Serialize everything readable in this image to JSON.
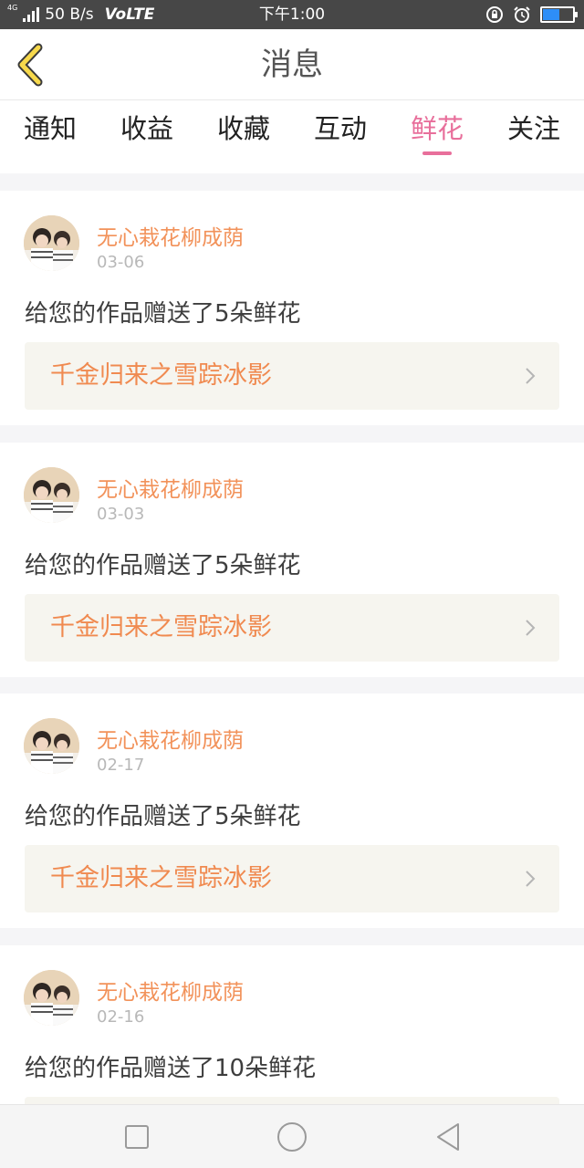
{
  "status_bar": {
    "network_type": "4G",
    "speed": "50 B/s",
    "volte": "VoLTE",
    "time": "下午1:00",
    "icons": [
      "rotation-lock-icon",
      "alarm-icon",
      "battery-icon"
    ],
    "battery_level": 0.55,
    "battery_color": "#2e8ef7"
  },
  "header": {
    "back_icon": "chevron-left-icon",
    "title": "消息"
  },
  "tabs": [
    {
      "label": "通知",
      "active": false
    },
    {
      "label": "收益",
      "active": false
    },
    {
      "label": "收藏",
      "active": false
    },
    {
      "label": "互动",
      "active": false
    },
    {
      "label": "鲜花",
      "active": true
    },
    {
      "label": "关注",
      "active": false
    }
  ],
  "colors": {
    "accent": "#e86f9b",
    "username": "#f2925a",
    "work_title": "#f08a50",
    "work_bg": "#f6f5ef"
  },
  "messages": [
    {
      "user": "无心栽花柳成荫",
      "date": "03-06",
      "text": "给您的作品赠送了5朵鲜花",
      "work": "千金归来之雪踪冰影"
    },
    {
      "user": "无心栽花柳成荫",
      "date": "03-03",
      "text": "给您的作品赠送了5朵鲜花",
      "work": "千金归来之雪踪冰影"
    },
    {
      "user": "无心栽花柳成荫",
      "date": "02-17",
      "text": "给您的作品赠送了5朵鲜花",
      "work": "千金归来之雪踪冰影"
    },
    {
      "user": "无心栽花柳成荫",
      "date": "02-16",
      "text": "给您的作品赠送了10朵鲜花",
      "work": ""
    }
  ],
  "nav_bar": [
    "square-icon",
    "circle-icon",
    "triangle-back-icon"
  ]
}
